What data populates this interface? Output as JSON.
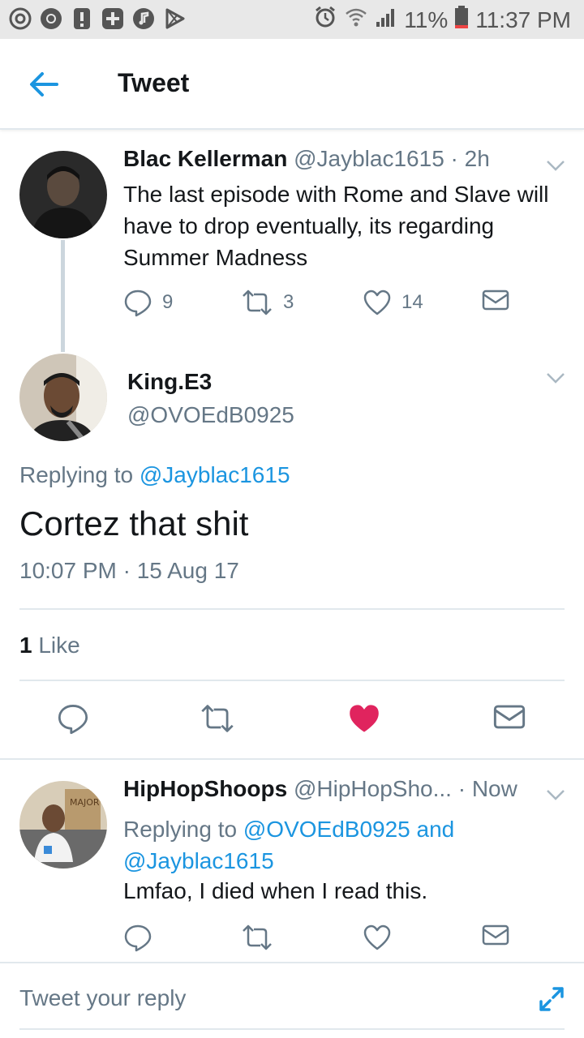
{
  "status_bar": {
    "battery": "11%",
    "time": "11:37 PM",
    "left_icons": [
      "mail-sync-icon",
      "chrome-icon",
      "alert-icon",
      "plus-icon",
      "music-icon",
      "play-store-icon"
    ],
    "right_icons": [
      "alarm-icon",
      "wifi-icon",
      "signal-icon",
      "battery-icon"
    ]
  },
  "header": {
    "title": "Tweet"
  },
  "parent_tweet": {
    "name": "Blac Kellerman",
    "handle": "@Jayblac1615",
    "time": "· 2h",
    "text": "The last episode with Rome and Slave will have to drop eventually, its regarding Summer Madness",
    "replies": "9",
    "retweets": "3",
    "likes": "14"
  },
  "focused_tweet": {
    "name": "King.E3",
    "handle": "@OVOEdB0925",
    "replying_prefix": "Replying to ",
    "replying_to": "@Jayblac1615",
    "text": "Cortez that shit",
    "timestamp": "10:07 PM · 15 Aug 17",
    "likes_count": "1",
    "likes_label": " Like",
    "liked": true
  },
  "reply_tweet": {
    "name": "HipHopShoops",
    "handle": "@HipHopSho...",
    "time": "· Now",
    "replying_prefix": "Replying to ",
    "replying_to_1": "@OVOEdB0925",
    "replying_and": " and",
    "replying_to_2": "@Jayblac1615",
    "text": "Lmfao, I died when I read this."
  },
  "compose": {
    "placeholder": "Tweet your reply"
  },
  "colors": {
    "accent": "#1b95e0",
    "like": "#e0245e",
    "text": "#14171a",
    "secondary": "#657786",
    "divider": "#e1e8ed"
  }
}
